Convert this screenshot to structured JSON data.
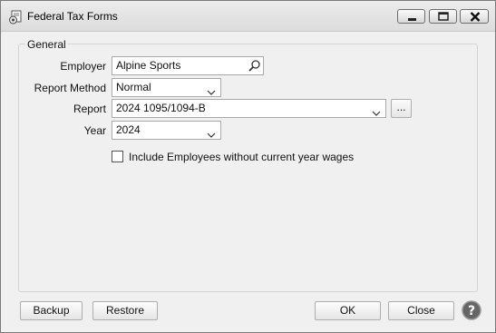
{
  "window": {
    "title": "Federal Tax Forms"
  },
  "group": {
    "title": "General"
  },
  "form": {
    "employer": {
      "label": "Employer",
      "value": "Alpine Sports"
    },
    "report_method": {
      "label": "Report Method",
      "value": "Normal"
    },
    "report": {
      "label": "Report",
      "value": "2024 1095/1094-B",
      "browse_label": "..."
    },
    "year": {
      "label": "Year",
      "value": "2024"
    },
    "include_employees": {
      "label": "Include Employees without current year wages",
      "checked": false
    }
  },
  "buttons": {
    "backup": "Backup",
    "restore": "Restore",
    "ok": "OK",
    "close": "Close"
  },
  "icons": {
    "app": "tax-forms-icon",
    "minimize": "minimize-icon",
    "maximize": "maximize-icon",
    "close": "close-icon",
    "search": "search-icon",
    "dropdown": "chevron-down-icon",
    "help": "help-icon"
  }
}
